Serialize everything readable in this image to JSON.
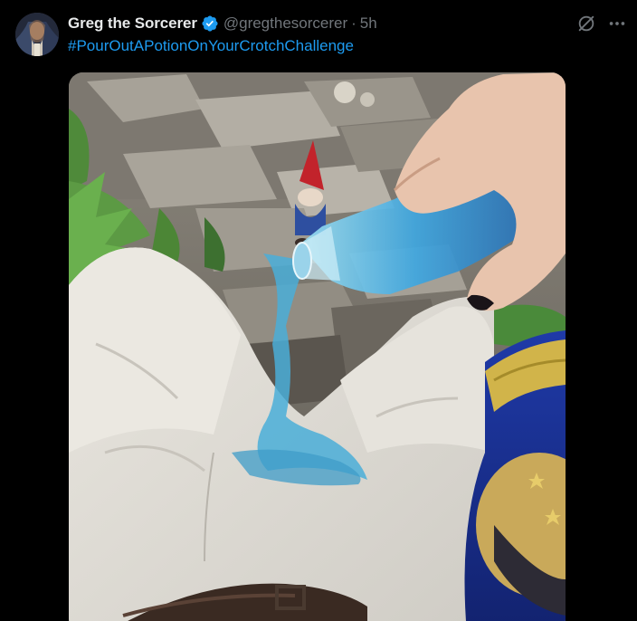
{
  "tweet": {
    "display_name": "Greg the Sorcerer",
    "handle": "@gregthesorcerer",
    "separator": "·",
    "time": "5h",
    "text": "#PourOutAPotionOnYourCrotchChallenge",
    "verified": true
  },
  "icons": {
    "verified": "verified-badge-icon",
    "grok": "grok-icon",
    "more": "more-options-icon"
  },
  "colors": {
    "background": "#000000",
    "name": "#e7e9ea",
    "muted": "#71767b",
    "link": "#1d9bf0",
    "verified": "#1d9bf0"
  }
}
